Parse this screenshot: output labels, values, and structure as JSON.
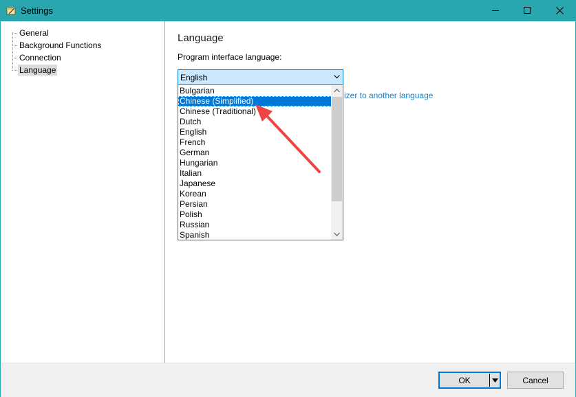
{
  "window": {
    "title": "Settings",
    "accent_color": "#2aa6ae"
  },
  "tree": {
    "items": [
      {
        "label": "General",
        "selected": false
      },
      {
        "label": "Background Functions",
        "selected": false
      },
      {
        "label": "Connection",
        "selected": false
      },
      {
        "label": "Language",
        "selected": true
      }
    ]
  },
  "panel": {
    "section_title": "Language",
    "field_label": "Program interface language:",
    "selected_language": "English",
    "hint_link_text": "izer to another language"
  },
  "dropdown": {
    "options": [
      "Bulgarian",
      "Chinese (Simplified)",
      "Chinese (Traditional)",
      "Dutch",
      "English",
      "French",
      "German",
      "Hungarian",
      "Italian",
      "Japanese",
      "Korean",
      "Persian",
      "Polish",
      "Russian",
      "Spanish"
    ],
    "highlighted_option": "Chinese (Simplified)",
    "highlight_color": "#0078d7"
  },
  "buttons": {
    "ok_label": "OK",
    "cancel_label": "Cancel"
  },
  "annotation": {
    "arrow_color": "#ee4444",
    "points_to": "Chinese (Simplified)"
  },
  "icons": [
    "app-icon",
    "minimize-icon",
    "maximize-icon",
    "close-icon",
    "chevron-down-icon",
    "scroll-up-icon",
    "scroll-down-icon",
    "split-arrow-icon"
  ]
}
